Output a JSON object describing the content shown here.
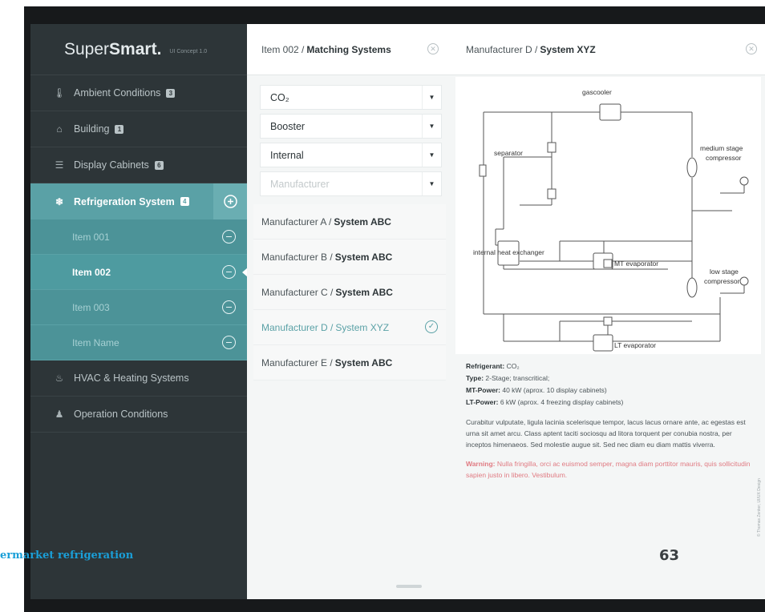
{
  "brand": {
    "name_light": "Super",
    "name_bold": "Smart.",
    "version": "UI Concept 1.0"
  },
  "sidebar": {
    "items": [
      {
        "label": "Ambient Conditions",
        "badge": "3",
        "icon": "thermometer-icon"
      },
      {
        "label": "Building",
        "badge": "1",
        "icon": "house-icon"
      },
      {
        "label": "Display Cabinets",
        "badge": "6",
        "icon": "cabinet-icon"
      },
      {
        "label": "Refrigeration System",
        "badge": "4",
        "icon": "snowflake-icon"
      },
      {
        "label": "HVAC & Heating Systems",
        "badge": "",
        "icon": "hvac-icon"
      },
      {
        "label": "Operation Conditions",
        "badge": "",
        "icon": "people-icon"
      }
    ],
    "sub_items": [
      {
        "label": "Item 001"
      },
      {
        "label": "Item 002"
      },
      {
        "label": "Item 003"
      },
      {
        "label": "Item Name"
      }
    ]
  },
  "middle": {
    "title_prefix": "Item 002 /",
    "title_bold": "Matching Systems",
    "dropdowns": [
      {
        "value": "CO₂"
      },
      {
        "value": "Booster"
      },
      {
        "value": "Internal"
      },
      {
        "value": "",
        "placeholder": "Manufacturer"
      }
    ],
    "matches": [
      {
        "maker": "Manufacturer A /",
        "system": "System ABC"
      },
      {
        "maker": "Manufacturer B /",
        "system": "System ABC"
      },
      {
        "maker": "Manufacturer C /",
        "system": "System ABC"
      },
      {
        "maker": "Manufacturer D /",
        "system": "System XYZ"
      },
      {
        "maker": "Manufacturer E /",
        "system": "System ABC"
      }
    ]
  },
  "detail": {
    "title_prefix": "Manufacturer D /",
    "title_bold": "System XYZ",
    "diagram_labels": {
      "gascooler": "gascooler",
      "separator": "separator",
      "medium_stage": "medium stage",
      "compressor1": "compressor",
      "internal_hx": "internal heat exchanger",
      "mt_evap": "MT evaporator",
      "low_stage": "low stage",
      "compressor2": "compressor",
      "lt_evap": "LT evaporator"
    },
    "refrigerant_label": "Refrigerant:",
    "refrigerant_value": "CO₂",
    "type_label": "Type:",
    "type_value": "2-Stage; transcritical;",
    "mt_label": "MT-Power:",
    "mt_value": "40 kW (aprox. 10 display cabinets)",
    "lt_label": "LT-Power:",
    "lt_value": "6 kW (aprox. 4 freezing display cabinets)",
    "paragraph": "Curabitur vulputate, ligula lacinia scelerisque tempor, lacus lacus ornare ante, ac egestas est urna sit amet arcu. Class aptent taciti sociosqu ad litora torquent per conubia nostra, per inceptos himenaeos. Sed molestie augue sit. Sed nec diam eu diam mattis viverra.",
    "warning_label": "Warning:",
    "warning_text": "Nulla fringilla, orci ac euismod semper, magna diam porttitor mauris, quis sollicitudin sapien justo in libero. Vestibulum.",
    "copyright": "© Thomas Zenker, UI/UX Design"
  },
  "footer": {
    "left_text": "ermarket refrigeration",
    "page_number": "63"
  },
  "colors": {
    "accent": "#5aa1a6",
    "sidebar": "#2d3538",
    "warning": "#e07a82",
    "footer_link": "#1a9fd8"
  }
}
